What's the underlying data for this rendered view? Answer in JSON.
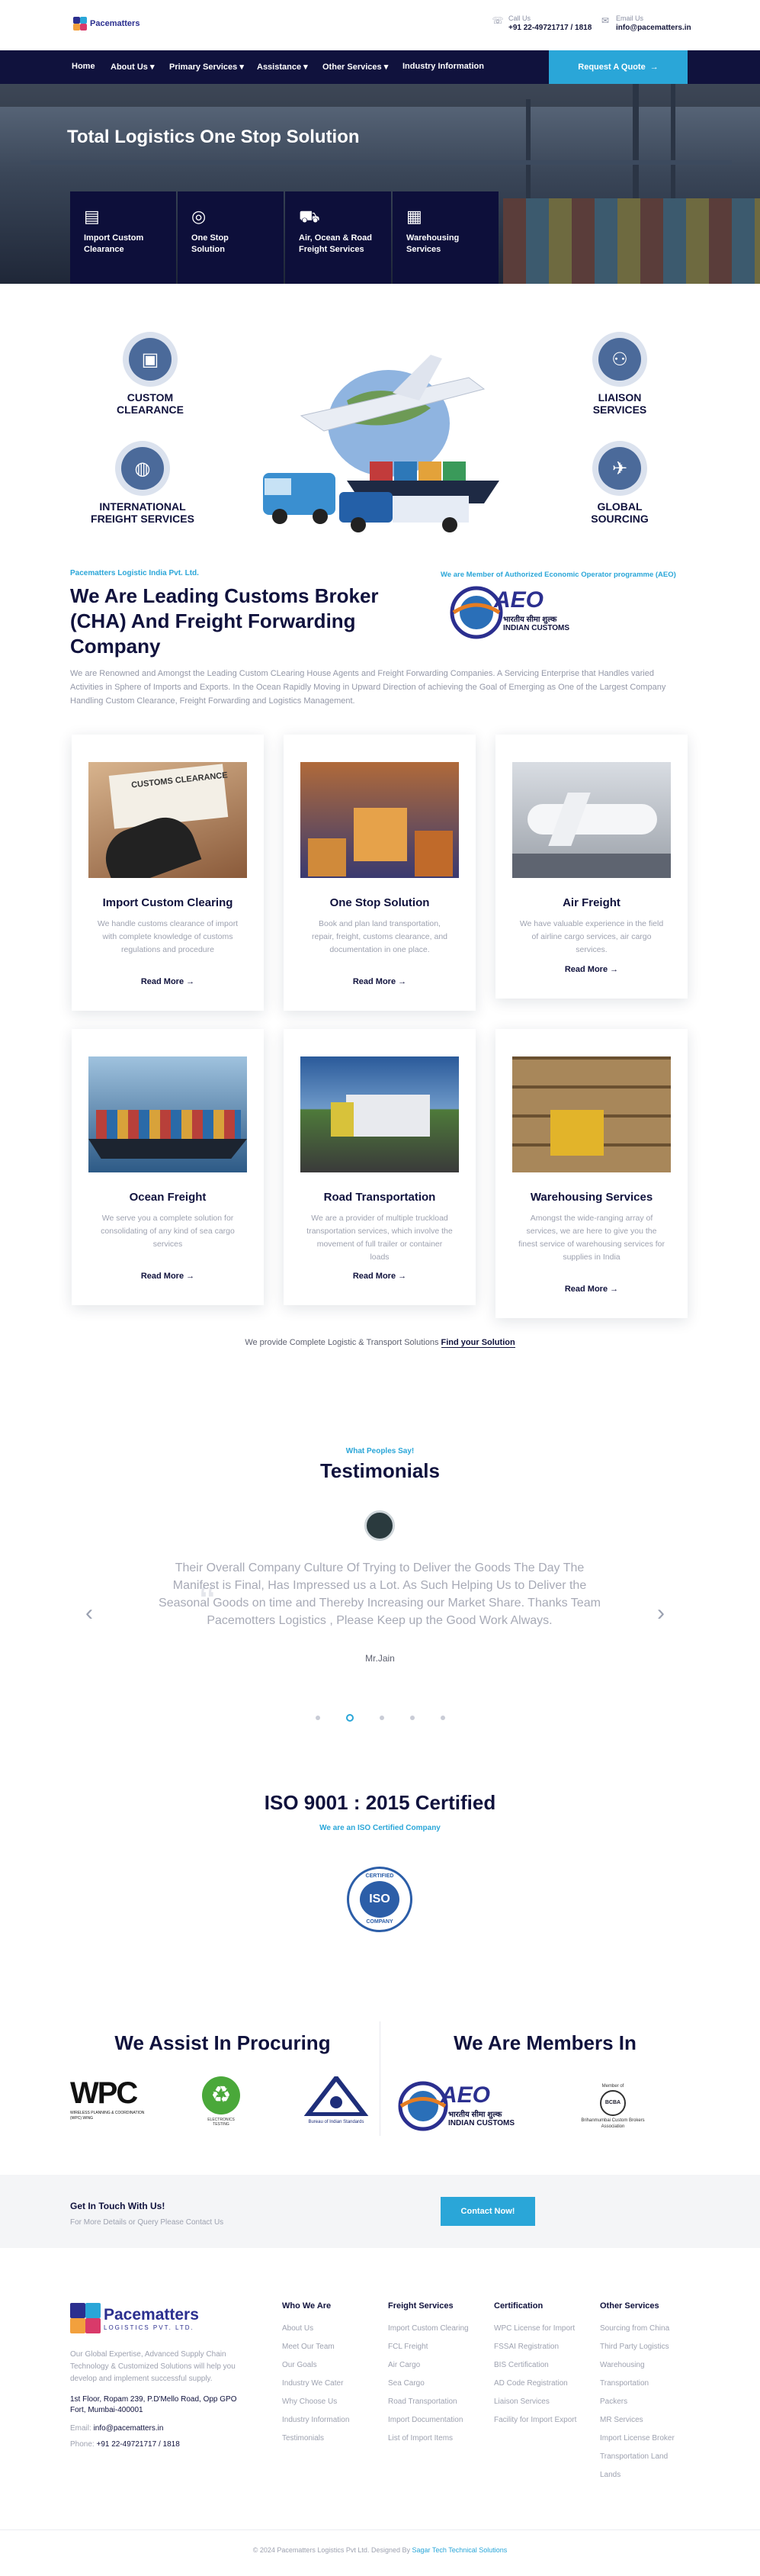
{
  "brand": {
    "name": "Pacematters",
    "tagline": "LOGISTICS PVT. LTD."
  },
  "header": {
    "call_label": "Call Us",
    "call_value": "+91 22-49721717 / 1818",
    "email_label": "Email Us",
    "email_value": "info@pacematters.in"
  },
  "nav": {
    "items": [
      "Home",
      "About Us",
      "Primary Services",
      "Assistance",
      "Other Services",
      "Industry Information"
    ],
    "cta": "Request A Quote"
  },
  "hero": {
    "title": "Total Logistics One Stop Solution",
    "tiles": [
      {
        "icon": "customs-icon",
        "line1": "Import Custom",
        "line2": "Clearance"
      },
      {
        "icon": "globe-icon",
        "line1": "One Stop",
        "line2": "Solution"
      },
      {
        "icon": "truck-icon",
        "line1": "Air, Ocean & Road",
        "line2": "Freight Services"
      },
      {
        "icon": "warehouse-icon",
        "line1": "Warehousing",
        "line2": "Services"
      }
    ]
  },
  "services_graphic": {
    "items": [
      {
        "line1": "CUSTOM",
        "line2": "CLEARANCE",
        "icon": "passport-icon"
      },
      {
        "line1": "LIAISON",
        "line2": "SERVICES",
        "icon": "handshake-icon"
      },
      {
        "line1": "INTERNATIONAL",
        "line2": "FREIGHT SERVICES",
        "icon": "globe-icon"
      },
      {
        "line1": "GLOBAL",
        "line2": "SOURCING",
        "icon": "plane-icon"
      }
    ]
  },
  "about": {
    "eyebrow": "Pacematters Logistic India Pvt. Ltd.",
    "heading": "We Are Leading Customs Broker (CHA) And Freight Forwarding Company",
    "aeo_caption": "We are Member of Authorized Economic Operator programme (AEO)",
    "aeo_logo": {
      "text": "AEO",
      "sub1": "भारतीय सीमा शुल्क",
      "sub2": "INDIAN CUSTOMS"
    },
    "para": "We are Renowned and Amongst the Leading Custom CLearing House Agents and Freight Forwarding Companies. A Servicing Enterprise that Handles varied Activities in Sphere of Imports and Exports. In the Ocean Rapidly Moving in Upward Direction of achieving the Goal of Emerging as One of the Largest Company Handling Custom Clearance, Freight Forwarding and Logistics Management."
  },
  "cards": [
    {
      "title": "Import Custom Clearing",
      "desc": "We handle customs clearance of import with complete knowledge of customs regulations and procedure",
      "more": "Read More"
    },
    {
      "title": "One Stop Solution",
      "desc": "Book and plan land transportation, repair, freight, customs clearance, and documentation in one place.",
      "more": "Read More"
    },
    {
      "title": "Air Freight",
      "desc": "We have valuable experience in the field of airline cargo services, air cargo services.",
      "more": "Read More"
    },
    {
      "title": "Ocean Freight",
      "desc": "We serve you a complete solution for consolidating of any kind of sea cargo services",
      "more": "Read More"
    },
    {
      "title": "Road Transportation",
      "desc": "We are a provider of multiple truckload transportation services, which involve the movement of full trailer or container loads",
      "more": "Read More"
    },
    {
      "title": "Warehousing Services",
      "desc": "Amongst the wide-ranging array of services, we are here to give you the finest service of warehousing services for supplies in India",
      "more": "Read More"
    }
  ],
  "solutions": {
    "text": "We provide Complete Logistic & Transport Solutions",
    "link": "Find your Solution"
  },
  "testimonials": {
    "eyebrow": "What Peoples Say!",
    "title": "Testimonials",
    "quote": "Their Overall Company Culture Of Trying to Deliver the Goods The Day The Manifest is Final, Has Impressed us a Lot. As Such Helping Us to Deliver the Seasonal Goods on time and Thereby Increasing our Market Share. Thanks Team Pacemotters Logistics , Please Keep up the Good Work Always.",
    "author": "Mr.Jain"
  },
  "iso": {
    "title": "ISO 9001 : 2015 Certified",
    "sub": "We are an ISO Certified Company",
    "badge_top": "CERTIFIED",
    "badge": "ISO",
    "badge_bottom": "COMPANY"
  },
  "procuring": {
    "title": "We Assist In Procuring",
    "wpc": "WPC",
    "wpc_sub": "WIRELESS PLANNING & COORDINATION (WPC) WING",
    "etdc": "ELECTRONICS TESTING",
    "bis": "Bureau of Indian Standards"
  },
  "members": {
    "title": "We Are Members In",
    "bcba_top": "Member of",
    "bcba": "BCBA",
    "bcba_sub": "Brihanmumbai Custom Brokers Association"
  },
  "get_in_touch": {
    "title": "Get In Touch With Us!",
    "sub": "For More Details or Query Please Contact Us",
    "button": "Contact Now!"
  },
  "footer": {
    "about": "Our Global Expertise, Advanced Supply Chain Technology & Customized Solutions will help you develop and implement successful supply.",
    "address": "1st Floor, Ropam 239, P.D'Mello Road, Opp GPO Fort, Mumbai-400001",
    "email_label": "Email:",
    "email": "info@pacematters.in",
    "phone_label": "Phone:",
    "phone": "+91 22-49721717 / 1818",
    "columns": [
      {
        "title": "Who We Are",
        "links": [
          "About Us",
          "Meet Our Team",
          "Our Goals",
          "Industry We Cater",
          "Why Choose Us",
          "Industry Information",
          "Testimonials"
        ]
      },
      {
        "title": "Freight Services",
        "links": [
          "Import Custom Clearing",
          "FCL Freight",
          "Air Cargo",
          "Sea Cargo",
          "Road Transportation",
          "Import Documentation",
          "List of Import Items"
        ]
      },
      {
        "title": "Certification",
        "links": [
          "WPC License for Import",
          "FSSAI Registration",
          "BIS Certification",
          "AD Code Registration",
          "Liaison Services",
          "Facility for Import Export"
        ]
      },
      {
        "title": "Other Services",
        "links": [
          "Sourcing from China",
          "Third Party Logistics",
          "Warehousing",
          "Transportation",
          "Packers",
          "MR Services",
          "Import License Broker",
          "Transportation Land",
          "Lands"
        ]
      }
    ],
    "copyright": "© 2024 Pacematters Logistics Pvt Ltd. Designed By",
    "designer": "Sagar Tech Technical Solutions"
  },
  "colors": {
    "navy": "#10123d",
    "accent": "#2aa6d8"
  }
}
